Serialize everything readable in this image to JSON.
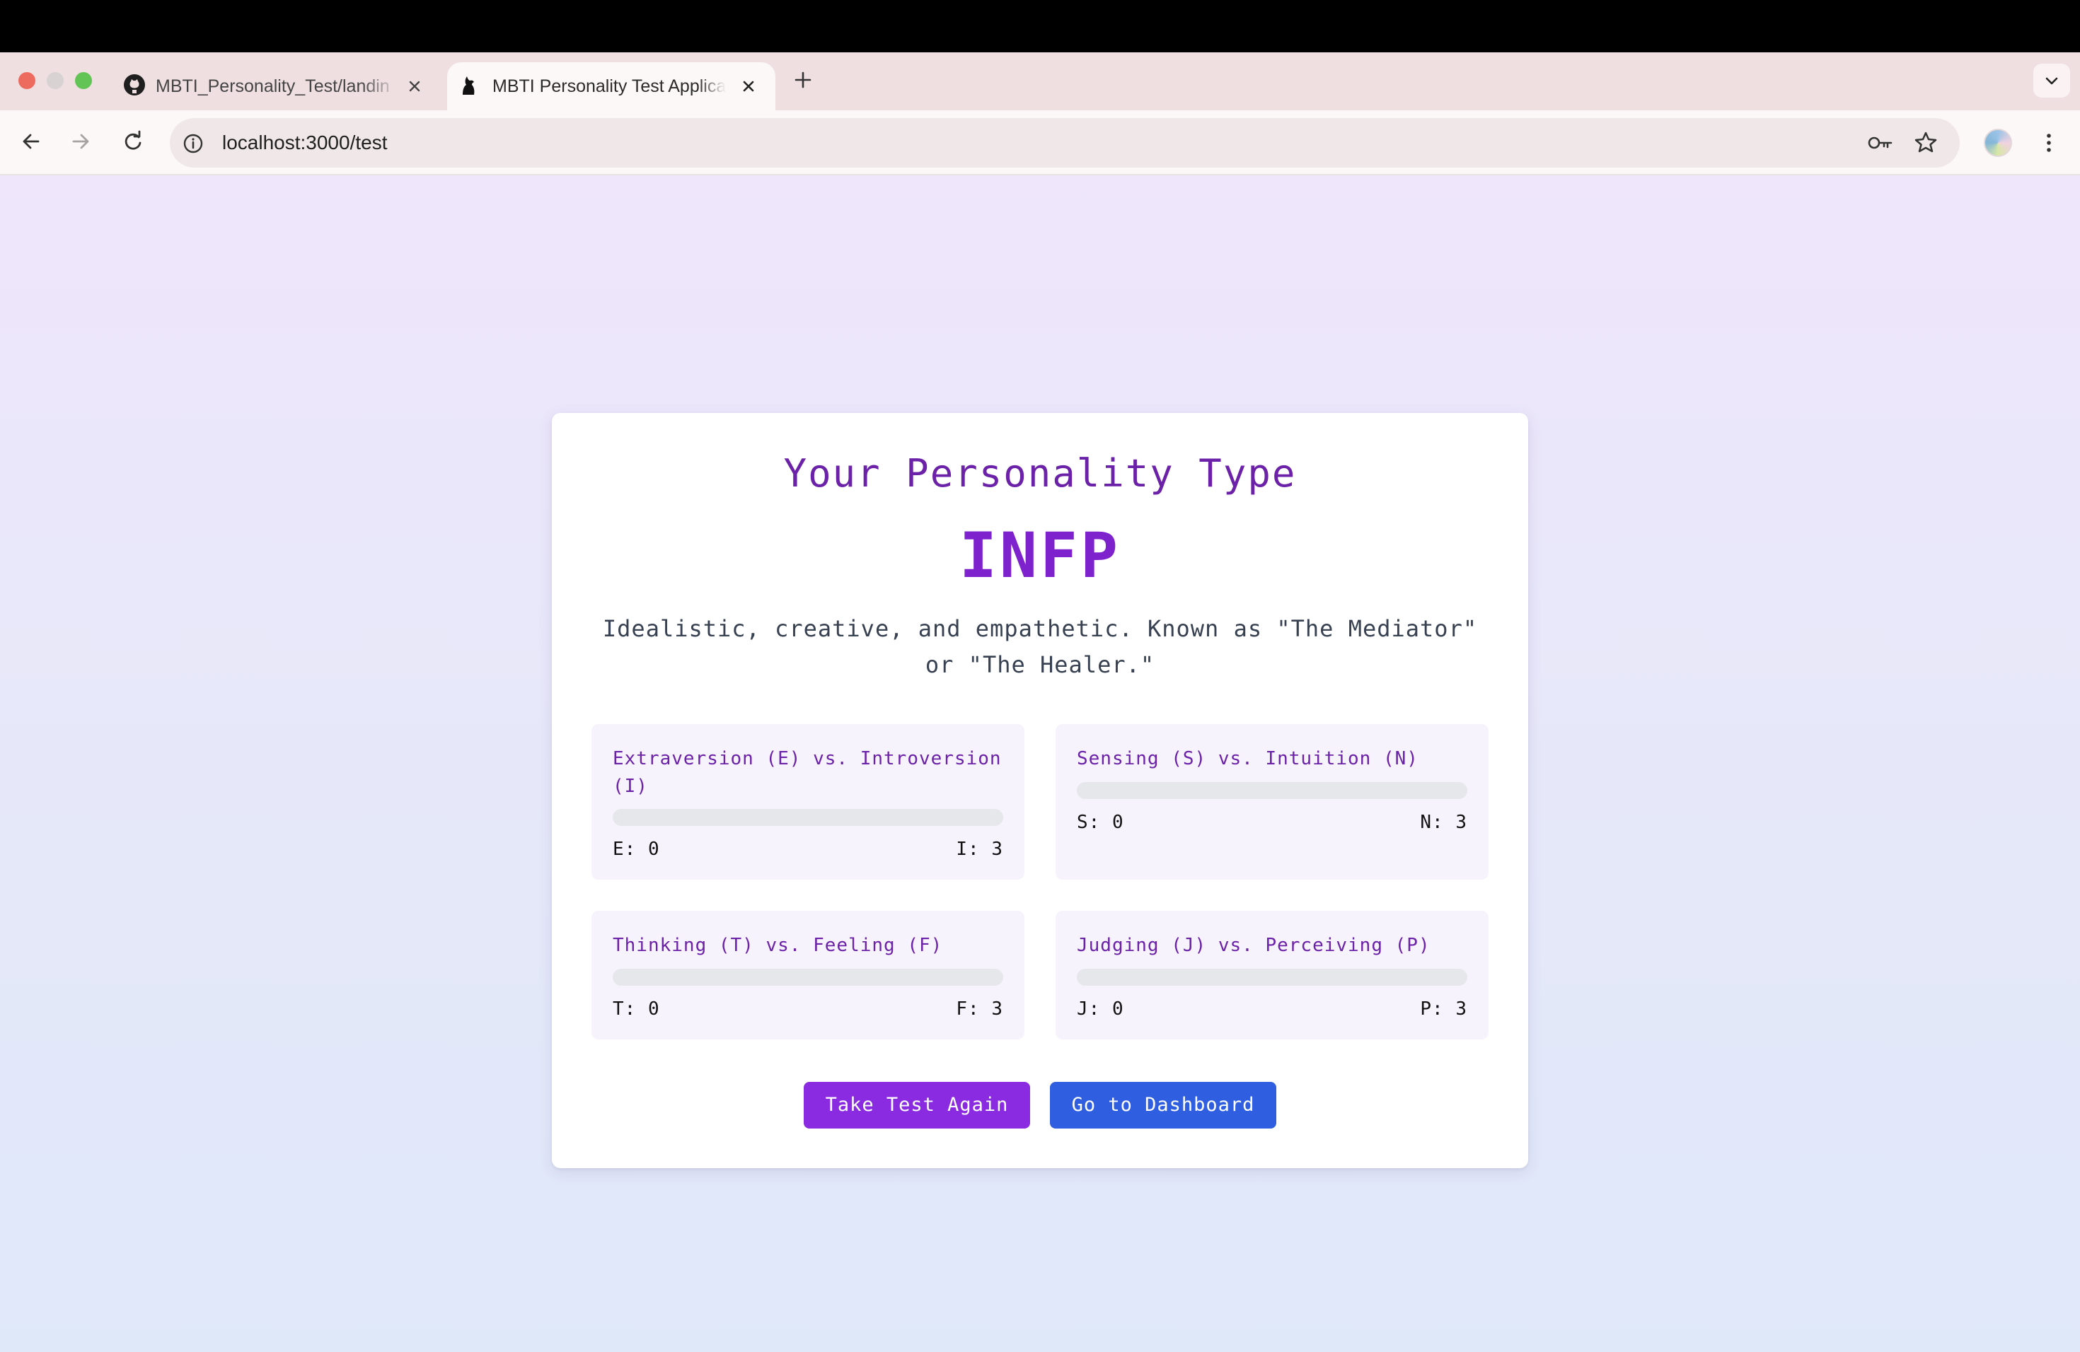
{
  "browser": {
    "tabs": [
      {
        "title": "MBTI_Personality_Test/landin",
        "icon": "github-icon",
        "active": false
      },
      {
        "title": "MBTI Personality Test Applica",
        "icon": "app-logo-icon",
        "active": true
      }
    ],
    "address": "localhost:3000/test"
  },
  "result": {
    "heading": "Your Personality Type",
    "type": "INFP",
    "description": "Idealistic, creative, and empathetic. Known as \"The Mediator\" or \"The Healer.\""
  },
  "dimensions": {
    "ei": {
      "title": "Extraversion (E) vs. Introversion (I)",
      "left_label": "E: 0",
      "right_label": "I: 3",
      "left_fraction": 0
    },
    "sn": {
      "title": "Sensing (S) vs. Intuition (N)",
      "left_label": "S: 0",
      "right_label": "N: 3",
      "left_fraction": 0
    },
    "tf": {
      "title": "Thinking (T) vs. Feeling (F)",
      "left_label": "T: 0",
      "right_label": "F: 3",
      "left_fraction": 0
    },
    "jp": {
      "title": "Judging (J) vs. Perceiving (P)",
      "left_label": "J: 0",
      "right_label": "P: 3",
      "left_fraction": 0
    }
  },
  "actions": {
    "take_again": "Take Test Again",
    "dashboard": "Go to Dashboard"
  },
  "colors": {
    "heading": "#6b21a8",
    "type": "#7e22ce",
    "primary_button": "#8a2be2",
    "secondary_button": "#2f5fe0",
    "bar_track": "#e5e7eb"
  }
}
